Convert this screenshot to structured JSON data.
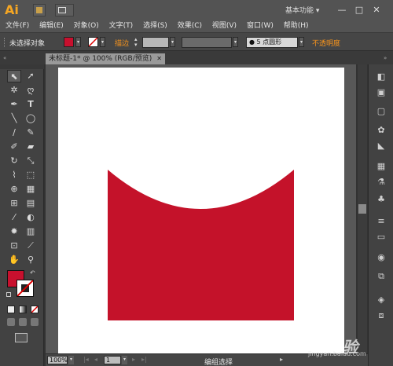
{
  "title": {
    "logo": "Ai",
    "workspace": "基本功能",
    "minimize": "—",
    "maximize": "□",
    "close": "✕"
  },
  "menu": [
    "文件(F)",
    "编辑(E)",
    "对象(O)",
    "文字(T)",
    "选择(S)",
    "效果(C)",
    "视图(V)",
    "窗口(W)",
    "帮助(H)"
  ],
  "control": {
    "selection_label": "未选择对象",
    "stroke_label": "描边",
    "brush_label": "5 点圆形",
    "opacity_label": "不透明度",
    "fill_color": "#c8102e"
  },
  "document": {
    "tab_title": "未标题-1* @ 100% (RGB/预览)",
    "tab_close": "✕"
  },
  "shape": {
    "fill": "#c4122a"
  },
  "status": {
    "zoom": "100%",
    "page": "1",
    "selection_tool": "编组选择"
  },
  "watermark": {
    "text": "Bai 经验",
    "url": "jingyan.baidu.com"
  },
  "colors": {
    "accent": "#f7941d",
    "fill_red": "#c4122a"
  }
}
